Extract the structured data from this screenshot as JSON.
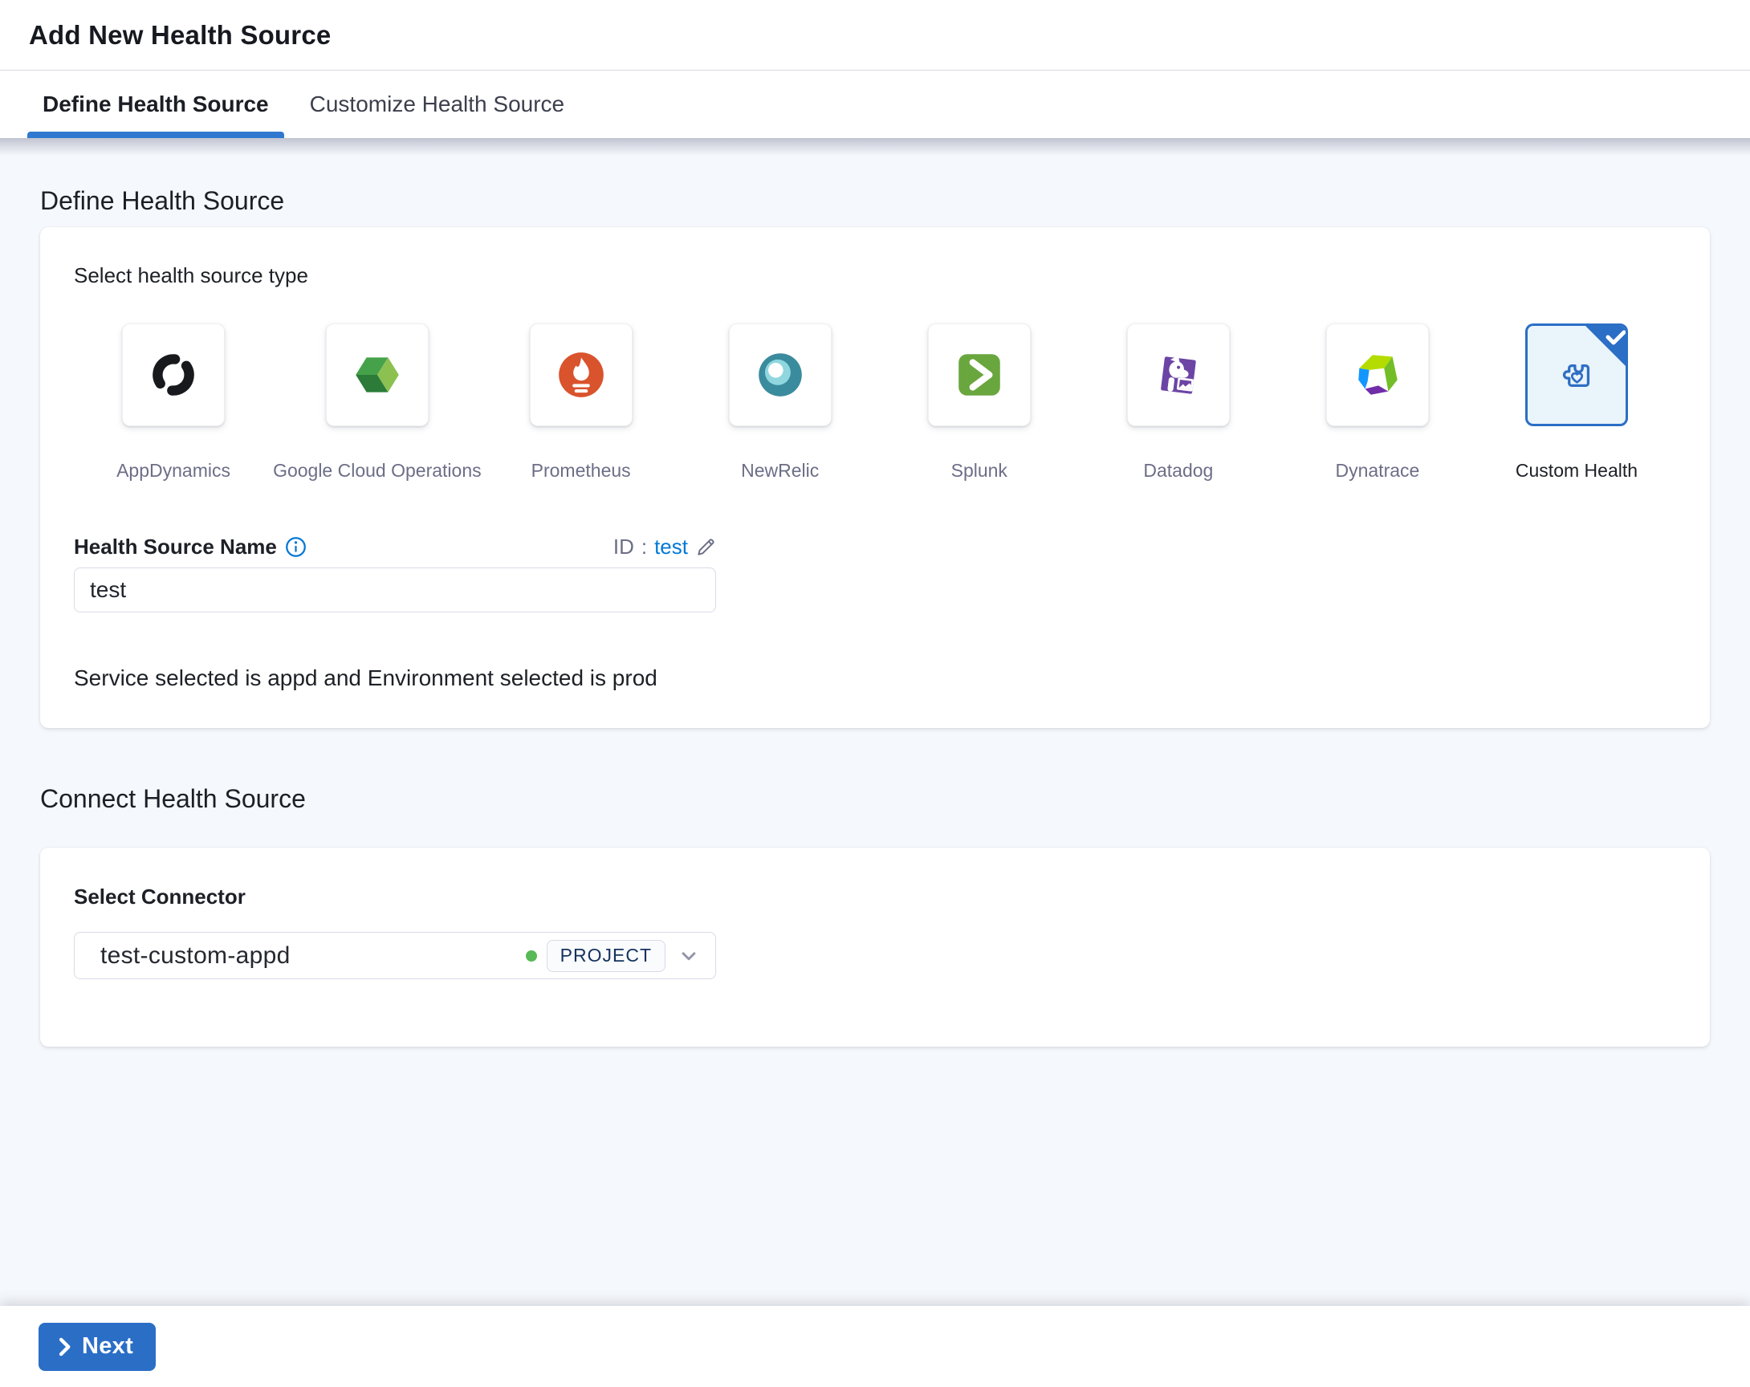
{
  "header": {
    "title": "Add New Health Source"
  },
  "tabs": [
    {
      "label": "Define Health Source",
      "active": true
    },
    {
      "label": "Customize Health Source",
      "active": false
    }
  ],
  "define_section": {
    "heading": "Define Health Source",
    "select_type_label": "Select health source type",
    "sources": [
      {
        "name": "AppDynamics",
        "icon": "appdynamics-icon",
        "selected": false
      },
      {
        "name": "Google Cloud Operations",
        "icon": "gco-icon",
        "selected": false
      },
      {
        "name": "Prometheus",
        "icon": "prometheus-icon",
        "selected": false
      },
      {
        "name": "NewRelic",
        "icon": "newrelic-icon",
        "selected": false
      },
      {
        "name": "Splunk",
        "icon": "splunk-icon",
        "selected": false
      },
      {
        "name": "Datadog",
        "icon": "datadog-icon",
        "selected": false
      },
      {
        "name": "Dynatrace",
        "icon": "dynatrace-icon",
        "selected": false
      },
      {
        "name": "Custom Health",
        "icon": "custom-health-icon",
        "selected": true
      }
    ],
    "name_label": "Health Source Name",
    "id_label": "ID",
    "id_separator": ":",
    "id_value": "test",
    "name_value": "test",
    "service_env_note": "Service selected is appd and Environment selected is prod"
  },
  "connect_section": {
    "heading": "Connect Health Source",
    "connector_label": "Select Connector",
    "connector_value": "test-custom-appd",
    "connector_status": "connected",
    "scope_badge": "PROJECT"
  },
  "footer": {
    "next_label": "Next"
  },
  "colors": {
    "accent": "#2b6ec6",
    "tab_underline": "#2f78d0",
    "link": "#0278d5",
    "dot_green": "#57ba57"
  }
}
